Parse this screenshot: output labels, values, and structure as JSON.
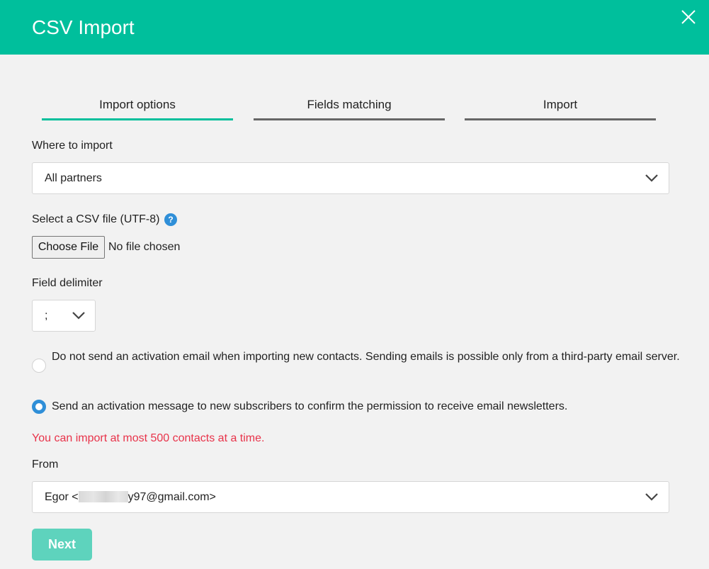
{
  "dialog": {
    "title": "CSV Import",
    "close_icon": "close-icon"
  },
  "steps": [
    {
      "label": "Import options",
      "active": true
    },
    {
      "label": "Fields matching",
      "active": false
    },
    {
      "label": "Import",
      "active": false
    }
  ],
  "where_to_import": {
    "label": "Where to import",
    "selected": "All partners"
  },
  "csv_file": {
    "label": "Select a CSV file (UTF-8)",
    "help_glyph": "?",
    "button_label": "Choose File",
    "status": "No file chosen"
  },
  "field_delimiter": {
    "label": "Field delimiter",
    "selected": ";"
  },
  "activation_options": [
    {
      "text": "Do not send an activation email when importing new contacts. Sending emails is possible only from a third-party email server.",
      "checked": false
    },
    {
      "text": "Send an activation message to new subscribers to confirm the permission to receive email newsletters.",
      "checked": true
    }
  ],
  "limit_warning": "You can import at most 500 contacts at a time.",
  "from": {
    "label": "From",
    "selected_prefix": "Egor <",
    "selected_suffix": "y97@gmail.com>"
  },
  "next_button": "Next",
  "colors": {
    "header": "#00bf9c",
    "active_step": "#00bf9c",
    "inactive_step": "#666666",
    "radio_on": "#2f8fd8",
    "warning": "#e8334a",
    "next_button": "#5ed3bd"
  }
}
